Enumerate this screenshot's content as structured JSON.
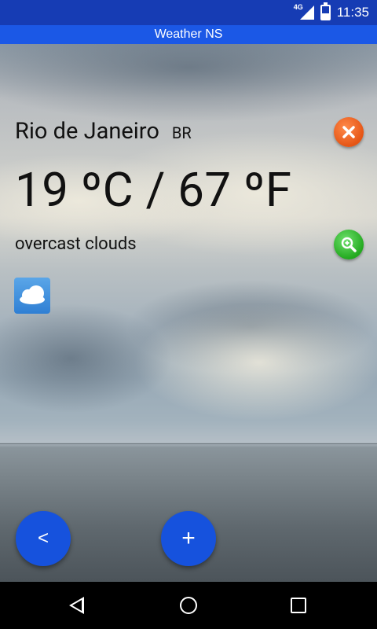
{
  "status_bar": {
    "network": "4G",
    "time": "11:35"
  },
  "app": {
    "title": "Weather NS"
  },
  "weather": {
    "city": "Rio de Janeiro",
    "country": "BR",
    "temperature": "19 ºC / 67 ºF",
    "condition": "overcast clouds",
    "condition_icon": "cloud-icon"
  },
  "buttons": {
    "close_icon": "close-icon",
    "search_icon": "search-zoom-icon",
    "back_label": "<",
    "add_label": "+"
  },
  "nav": {
    "back": "back-icon",
    "home": "home-icon",
    "recents": "recents-icon"
  },
  "colors": {
    "status_bar": "#163cb4",
    "app_bar": "#1b58e6",
    "fab": "#1652dd",
    "close_button": "#e55515",
    "search_button": "#23a91f"
  }
}
